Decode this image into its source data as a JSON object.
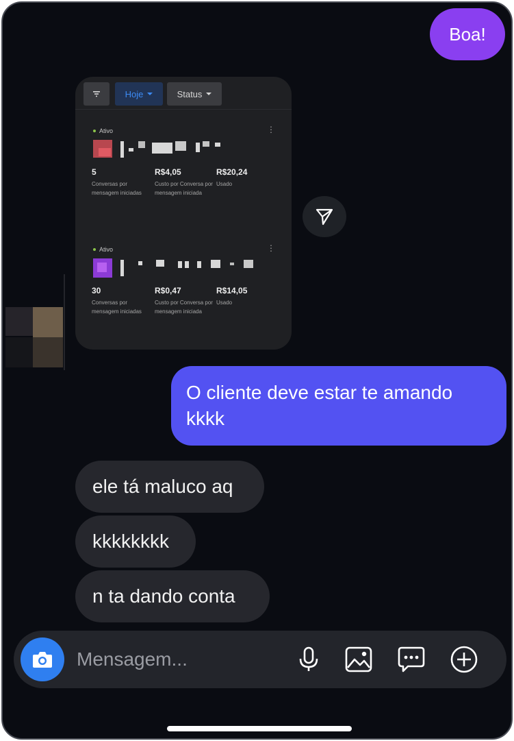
{
  "messages": {
    "sent_1": "Boa!",
    "sent_2": "O cliente deve estar te amando kkkk",
    "received": [
      "ele tá maluco aq",
      "kkkkkkkk",
      "n ta dando conta"
    ]
  },
  "shared_card": {
    "filters": {
      "icon": "filter-icon",
      "today": "Hoje",
      "status": "Status"
    },
    "campaigns": [
      {
        "status": "Ativo",
        "metrics": [
          {
            "value": "5",
            "label": "Conversas por mensagem iniciadas"
          },
          {
            "value": "R$4,05",
            "label": "Custo por Conversa por mensagem iniciada"
          },
          {
            "value": "R$20,24",
            "label": "Usado"
          }
        ]
      },
      {
        "status": "Ativo",
        "metrics": [
          {
            "value": "30",
            "label": "Conversas por mensagem iniciadas"
          },
          {
            "value": "R$0,47",
            "label": "Custo por Conversa por mensagem iniciada"
          },
          {
            "value": "R$14,05",
            "label": "Usado"
          }
        ]
      }
    ]
  },
  "composer": {
    "placeholder": "Mensagem...",
    "icons": [
      "camera-icon",
      "microphone-icon",
      "image-icon",
      "sticker-chat-icon",
      "add-icon"
    ]
  },
  "colors": {
    "background": "#0a0c12",
    "sent_purple": "#8a3ff0",
    "sent_blue": "#5352f2",
    "received_bubble": "#26272d",
    "camera_button": "#2f7ff0"
  }
}
